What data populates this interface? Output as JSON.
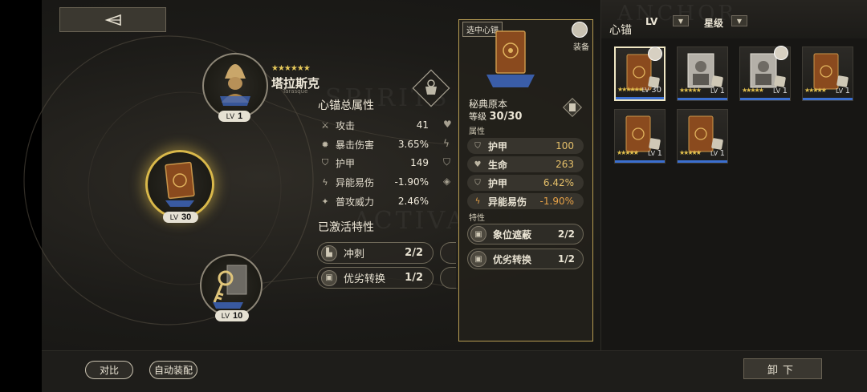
{
  "header": {
    "back_icon": "back-arrow-icon"
  },
  "character": {
    "name": "塔拉斯克",
    "subtitle": "Tarasque",
    "stars": "★★★★★★",
    "lv_label": "LV",
    "level": "1"
  },
  "orbit_nodes": {
    "selected": {
      "lv_label": "LV",
      "level": "30"
    },
    "key": {
      "lv_label": "LV",
      "level": "10"
    }
  },
  "total_stats": {
    "title": "心锚总属性",
    "rows": [
      {
        "icon": "sword-icon",
        "name": "攻击",
        "value": "41"
      },
      {
        "icon": "gear-icon",
        "name": "暴击伤害",
        "value": "3.65%"
      },
      {
        "icon": "shield-icon",
        "name": "护甲",
        "value": "149"
      },
      {
        "icon": "lightning-icon",
        "name": "异能易伤",
        "value": "-1.90%"
      },
      {
        "icon": "burst-icon",
        "name": "普攻威力",
        "value": "2.46%"
      }
    ]
  },
  "watermarks": {
    "top": "SPIRITS",
    "bottom": "ACTIVATED",
    "right": "ANCHOR"
  },
  "activated_traits": {
    "title": "已激活特性",
    "rows": [
      {
        "name": "冲刺",
        "value": "2/2"
      },
      {
        "name": "优劣转换",
        "value": "1/2"
      }
    ]
  },
  "popup": {
    "tag": "选中心锚",
    "equip_label": "装备",
    "item_name": "秘典原本",
    "level_label": "等级",
    "level_value": "30/30",
    "attr_title": "属性",
    "attrs": [
      {
        "icon": "shield-icon",
        "name": "护甲",
        "value": "100"
      },
      {
        "icon": "heart-icon",
        "name": "生命",
        "value": "263"
      },
      {
        "icon": "shield-icon",
        "name": "护甲",
        "value": "6.42%"
      },
      {
        "icon": "lightning-icon",
        "name": "异能易伤",
        "value": "-1.90%"
      }
    ],
    "trait_title": "特性",
    "traits": [
      {
        "name": "象位遮蔽",
        "value": "2/2"
      },
      {
        "name": "优劣转换",
        "value": "1/2"
      }
    ]
  },
  "inventory": {
    "title": "心锚",
    "sort_lv": "LV",
    "sort_rarity": "星级",
    "cards": [
      {
        "lv_label": "LV",
        "level": "30",
        "stars": "★★★★★★",
        "selected": true,
        "equipped": true
      },
      {
        "lv_label": "LV",
        "level": "1",
        "stars": "★★★★★",
        "selected": false,
        "equipped": false
      },
      {
        "lv_label": "LV",
        "level": "1",
        "stars": "★★★★★",
        "selected": false,
        "equipped": true
      },
      {
        "lv_label": "LV",
        "level": "1",
        "stars": "★★★★★",
        "selected": false,
        "equipped": false
      },
      {
        "lv_label": "LV",
        "level": "1",
        "stars": "★★★★★",
        "selected": false,
        "equipped": false
      },
      {
        "lv_label": "LV",
        "level": "1",
        "stars": "★★★★★",
        "selected": false,
        "equipped": false
      }
    ]
  },
  "footer": {
    "compare": "对比",
    "auto_equip": "自动装配",
    "unload": "卸下"
  },
  "colors": {
    "accent_gold": "#d9b84a",
    "value_gold": "#e6c06a",
    "card_bar_blue": "#3b6fd0"
  }
}
